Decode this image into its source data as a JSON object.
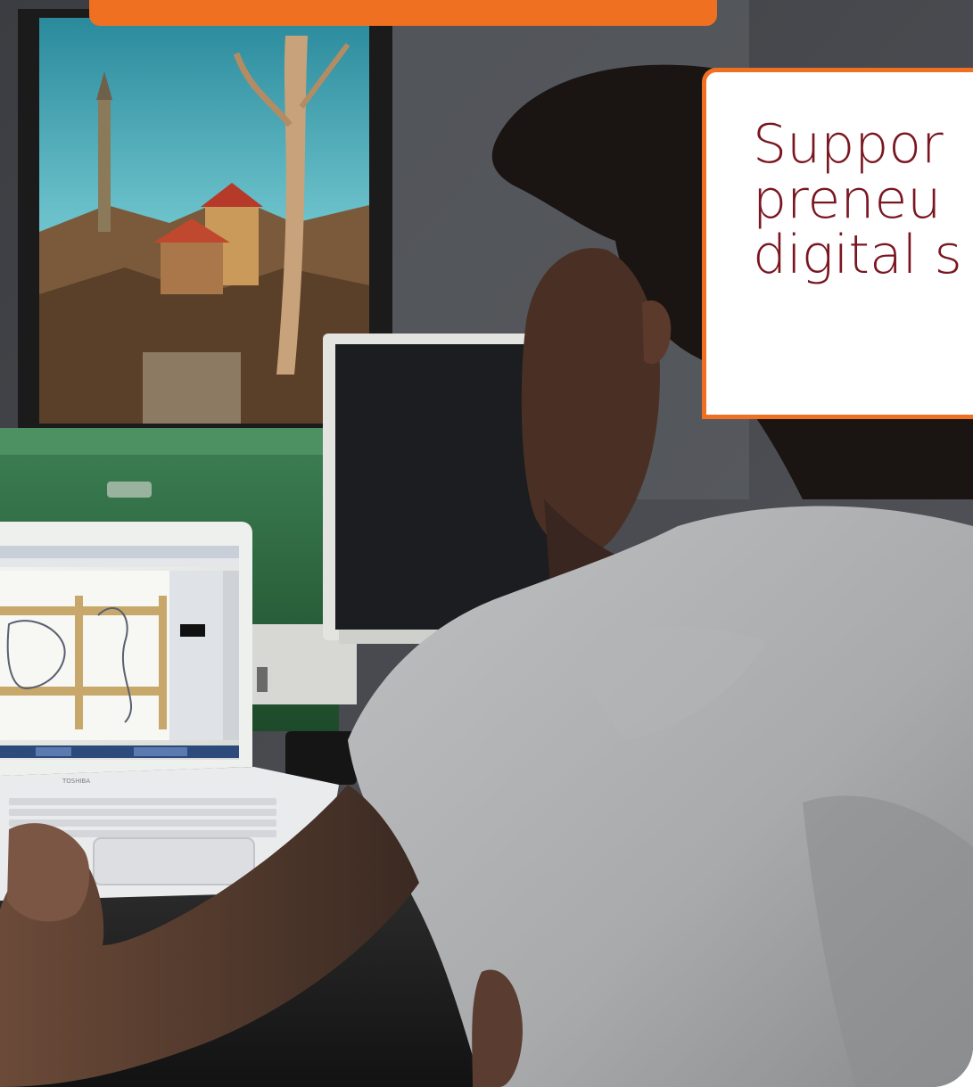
{
  "colors": {
    "accent_orange": "#f07022",
    "headline_maroon": "#7a1620",
    "wall_grey": "#4a4c52",
    "cabinet_green": "#2e6b3f",
    "painting_teal": "#4fa9b5",
    "laptop_white": "#e9eaec",
    "shirt_grey": "#c9cacc"
  },
  "caption": {
    "lines": [
      "Suppor",
      "preneu",
      "digital s"
    ]
  },
  "photo": {
    "laptop_brand": "TOSHIBA"
  },
  "icons": {
    "photo": "photograph"
  }
}
